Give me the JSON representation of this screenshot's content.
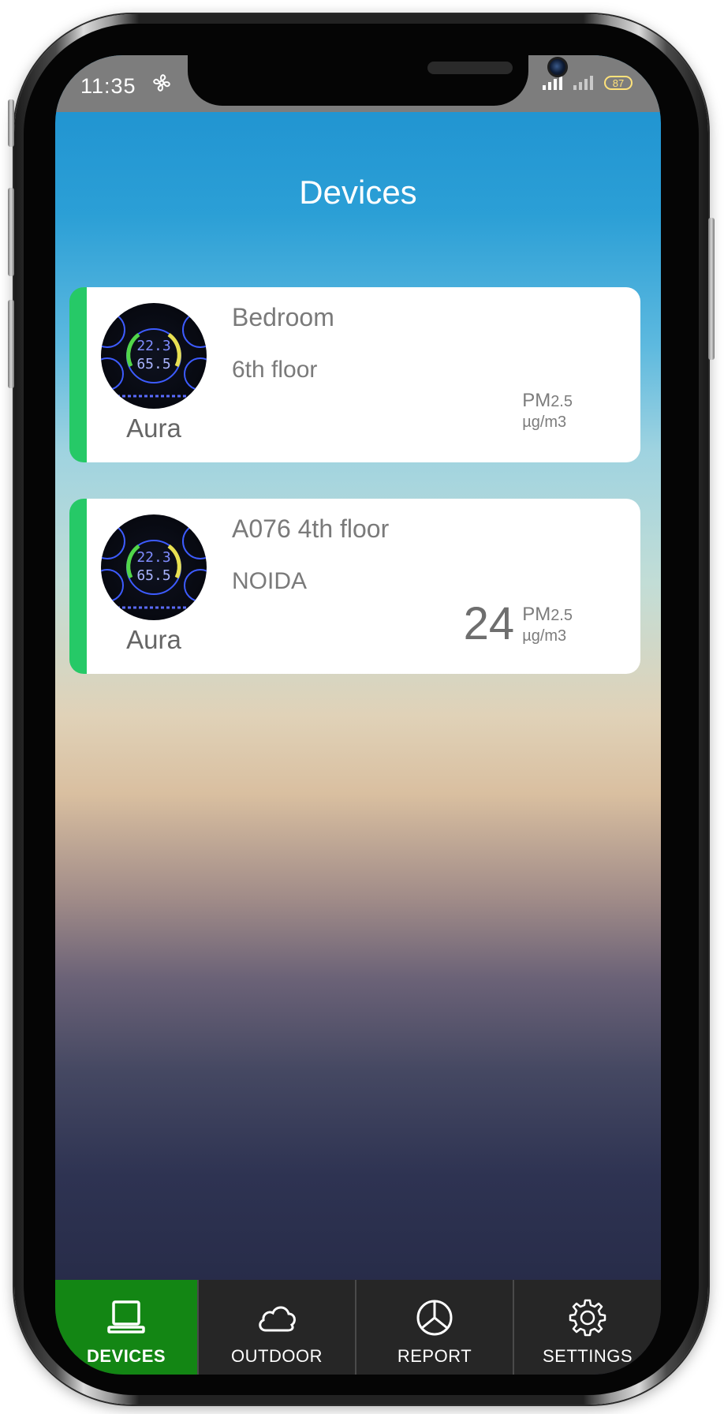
{
  "status_bar": {
    "time": "11:35",
    "battery": "87"
  },
  "header": {
    "title": "Devices"
  },
  "devices": [
    {
      "name": "Bedroom",
      "location": "6th floor",
      "type": "Aura",
      "value": "",
      "pm_label": "PM",
      "pm_sub": "2.5",
      "unit": "µg/m3",
      "status_color": "#26c967"
    },
    {
      "name": "A076 4th floor",
      "location": "NOIDA",
      "type": "Aura",
      "value": "24",
      "pm_label": "PM",
      "pm_sub": "2.5",
      "unit": "µg/m3",
      "status_color": "#26c967"
    }
  ],
  "device_display": {
    "temperature": "22.3",
    "humidity": "65.5"
  },
  "tabs": [
    {
      "label": "DEVICES",
      "icon": "laptop-icon",
      "active": true
    },
    {
      "label": "OUTDOOR",
      "icon": "cloud-icon",
      "active": false
    },
    {
      "label": "REPORT",
      "icon": "pie-chart-icon",
      "active": false
    },
    {
      "label": "SETTINGS",
      "icon": "gear-icon",
      "active": false
    }
  ],
  "colors": {
    "active_tab": "#138614",
    "tab_bar": "#262626",
    "status_indicator": "#26c967"
  }
}
